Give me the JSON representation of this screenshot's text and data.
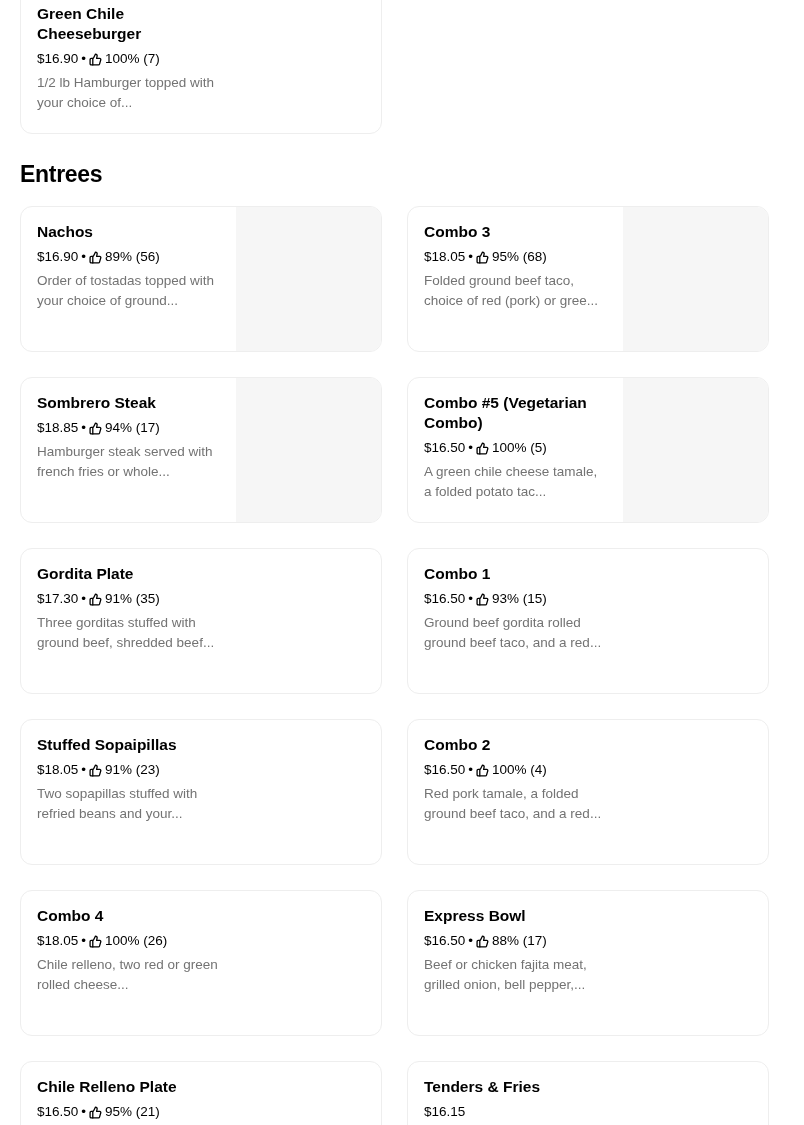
{
  "sections": [
    {
      "items": [
        {
          "name": "Green Chile Cheeseburger",
          "price": "$16.90",
          "separator": "•",
          "rating": "100% (7)",
          "description": "1/2 lb Hamburger topped with your choice of...",
          "image": false
        }
      ]
    },
    {
      "title": "Entrees",
      "items": [
        {
          "name": "Nachos",
          "price": "$16.90",
          "separator": "•",
          "rating": "89% (56)",
          "description": "Order of tostadas topped with your choice of ground...",
          "image": true
        },
        {
          "name": "Combo 3",
          "price": "$18.05",
          "separator": "•",
          "rating": "95% (68)",
          "description": "Folded ground beef taco, choice of red (pork) or gree...",
          "image": true
        },
        {
          "name": "Sombrero Steak",
          "price": "$18.85",
          "separator": "•",
          "rating": "94% (17)",
          "description": "Hamburger steak served with french fries or whole...",
          "image": true
        },
        {
          "name": "Combo #5 (Vegetarian Combo)",
          "price": "$16.50",
          "separator": "•",
          "rating": "100% (5)",
          "description": "A green chile cheese tamale, a folded potato tac...",
          "image": true
        },
        {
          "name": "Gordita Plate",
          "price": "$17.30",
          "separator": "•",
          "rating": "91% (35)",
          "description": "Three gorditas stuffed with ground beef, shredded beef...",
          "image": false
        },
        {
          "name": "Combo 1",
          "price": "$16.50",
          "separator": "•",
          "rating": "93% (15)",
          "description": "Ground beef gordita rolled ground beef taco, and a red...",
          "image": false
        },
        {
          "name": "Stuffed Sopaipillas",
          "price": "$18.05",
          "separator": "•",
          "rating": "91% (23)",
          "description": "Two sopapillas stuffed with refried beans and your...",
          "image": false
        },
        {
          "name": "Combo 2",
          "price": "$16.50",
          "separator": "•",
          "rating": "100% (4)",
          "description": "Red pork tamale, a folded ground beef taco, and a red...",
          "image": false
        },
        {
          "name": "Combo 4",
          "price": "$18.05",
          "separator": "•",
          "rating": "100% (26)",
          "description": "Chile relleno, two red or green rolled cheese...",
          "image": false
        },
        {
          "name": "Express Bowl",
          "price": "$16.50",
          "separator": "•",
          "rating": "88% (17)",
          "description": "Beef or chicken fajita meat, grilled onion, bell pepper,...",
          "image": false
        },
        {
          "name": "Chile Relleno Plate",
          "price": "$16.50",
          "separator": "•",
          "rating": "95% (21)",
          "image": false
        },
        {
          "name": "Tenders & Fries",
          "price": "$16.15",
          "image": false
        }
      ]
    }
  ]
}
